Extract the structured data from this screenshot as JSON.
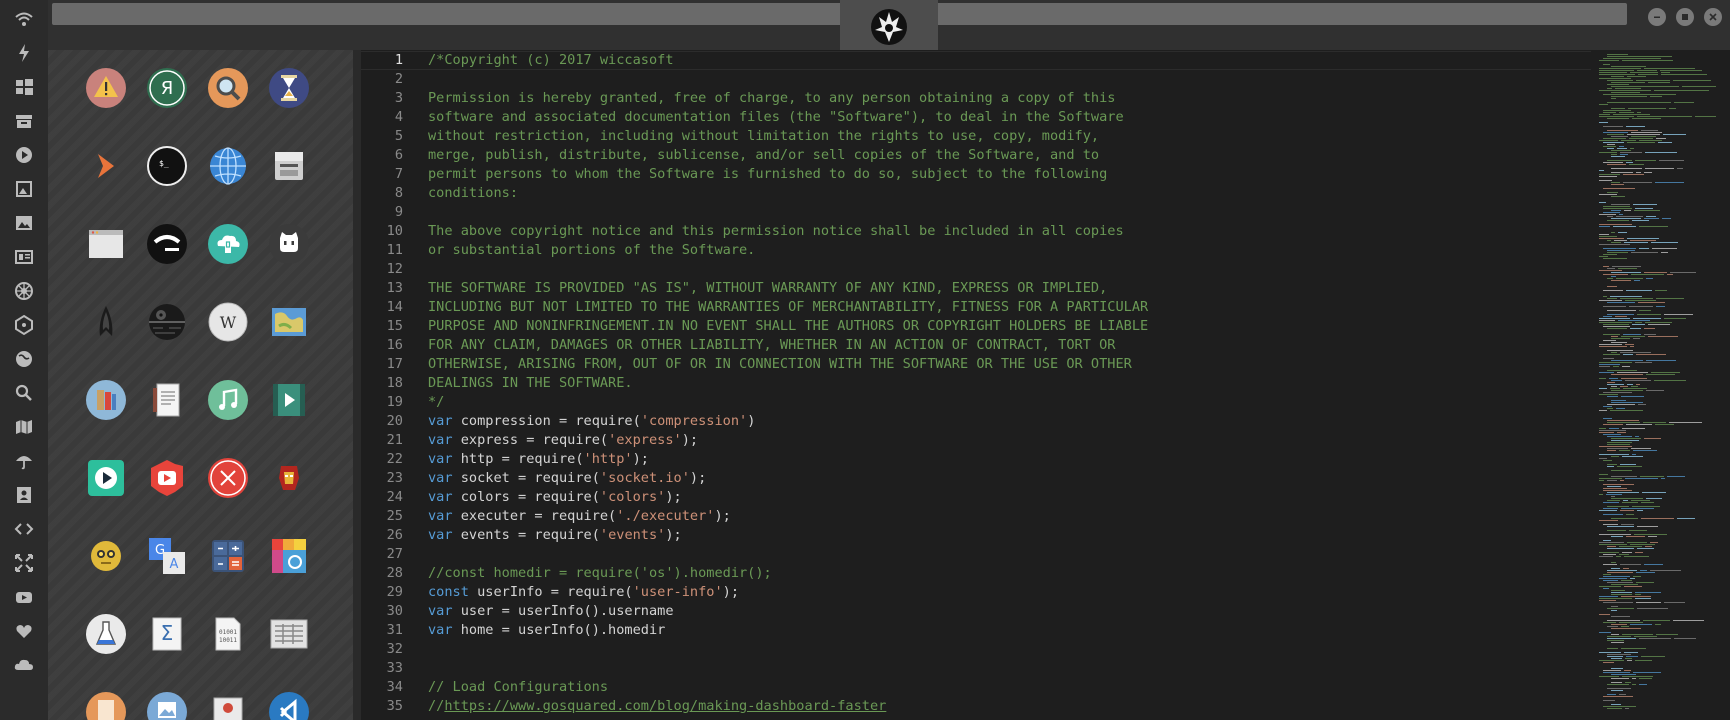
{
  "window": {
    "logo_icon": "rebel-alliance-icon",
    "controls": [
      "minimize-icon",
      "maximize-icon",
      "close-icon"
    ]
  },
  "sidebar": {
    "icons": [
      "wifi-icon",
      "bolt-icon",
      "windows-icon",
      "archive-icon",
      "play-circle-icon",
      "photo-album-icon",
      "image-icon",
      "news-icon",
      "galactic-empire-icon",
      "atom-icon",
      "globe-icon",
      "search-icon",
      "map-icon",
      "umbrella-icon",
      "contacts-icon",
      "code-icon",
      "expand-icon",
      "youtube-icon",
      "heart-icon",
      "cloud-icon"
    ]
  },
  "launcher": {
    "apps": [
      "warning-icon",
      "yandex-icon",
      "search-icon",
      "hourglass-icon",
      "terminal-prompt-icon",
      "terminal-icon",
      "globe-icon",
      "scanner-icon",
      "window-icon",
      "ubuntu-icon",
      "cloud-lock-icon",
      "github-icon",
      "star-trek-icon",
      "death-star-icon",
      "wikipedia-icon",
      "map-icon",
      "books-icon",
      "document-icon",
      "music-icon",
      "video-icon",
      "play-icon",
      "youtube-icon",
      "close-circle-icon",
      "iron-man-icon",
      "c3po-icon",
      "translate-icon",
      "calculator-icon",
      "color-picker-icon",
      "flask-icon",
      "math-icon",
      "binary-icon",
      "spreadsheet-icon",
      "text-file-icon",
      "image-viewer-icon",
      "presentation-icon",
      "vscode-icon"
    ]
  },
  "editor": {
    "active_line": 1,
    "colors": {
      "keyword": "#569cd6",
      "string": "#ce9178",
      "comment": "#6a9955",
      "text": "#d4d4d4"
    },
    "lines": [
      {
        "n": "1",
        "parts": [
          {
            "t": "/*Copyright (c) 2017 wiccasoft",
            "c": "cm"
          }
        ]
      },
      {
        "n": "2",
        "parts": []
      },
      {
        "n": "3",
        "parts": [
          {
            "t": "Permission is hereby granted, free of charge, to any person obtaining a copy of this",
            "c": "cm"
          }
        ]
      },
      {
        "n": "4",
        "parts": [
          {
            "t": "software and associated documentation files (the \"Software\"), to deal in the Software",
            "c": "cm"
          }
        ]
      },
      {
        "n": "5",
        "parts": [
          {
            "t": "without restriction, including without limitation the rights to use, copy, modify,",
            "c": "cm"
          }
        ]
      },
      {
        "n": "6",
        "parts": [
          {
            "t": "merge, publish, distribute, sublicense, and/or sell copies of the Software, and to",
            "c": "cm"
          }
        ]
      },
      {
        "n": "7",
        "parts": [
          {
            "t": "permit persons to whom the Software is furnished to do so, subject to the following",
            "c": "cm"
          }
        ]
      },
      {
        "n": "8",
        "parts": [
          {
            "t": "conditions:",
            "c": "cm"
          }
        ]
      },
      {
        "n": "9",
        "parts": []
      },
      {
        "n": "10",
        "parts": [
          {
            "t": "The above copyright notice and this permission notice shall be included in all copies",
            "c": "cm"
          }
        ]
      },
      {
        "n": "11",
        "parts": [
          {
            "t": "or substantial portions of the Software.",
            "c": "cm"
          }
        ]
      },
      {
        "n": "12",
        "parts": []
      },
      {
        "n": "13",
        "parts": [
          {
            "t": "THE SOFTWARE IS PROVIDED \"AS IS\", WITHOUT WARRANTY OF ANY KIND, EXPRESS OR IMPLIED,",
            "c": "cm"
          }
        ]
      },
      {
        "n": "14",
        "parts": [
          {
            "t": "INCLUDING BUT NOT LIMITED TO THE WARRANTIES OF MERCHANTABILITY, FITNESS FOR A PARTICULAR",
            "c": "cm"
          }
        ]
      },
      {
        "n": "15",
        "parts": [
          {
            "t": "PURPOSE AND NONINFRINGEMENT.IN NO EVENT SHALL THE AUTHORS OR COPYRIGHT HOLDERS BE LIABLE",
            "c": "cm"
          }
        ]
      },
      {
        "n": "16",
        "parts": [
          {
            "t": "FOR ANY CLAIM, DAMAGES OR OTHER LIABILITY, WHETHER IN AN ACTION OF CONTRACT, TORT OR",
            "c": "cm"
          }
        ]
      },
      {
        "n": "17",
        "parts": [
          {
            "t": "OTHERWISE, ARISING FROM, OUT OF OR IN CONNECTION WITH THE SOFTWARE OR THE USE OR OTHER",
            "c": "cm"
          }
        ]
      },
      {
        "n": "18",
        "parts": [
          {
            "t": "DEALINGS IN THE SOFTWARE.",
            "c": "cm"
          }
        ]
      },
      {
        "n": "19",
        "parts": [
          {
            "t": "*/",
            "c": "cm"
          }
        ]
      },
      {
        "n": "20",
        "parts": [
          {
            "t": "var",
            "c": "kw"
          },
          {
            "t": " compression = require(",
            "c": ""
          },
          {
            "t": "'compression'",
            "c": "str"
          },
          {
            "t": ")",
            "c": ""
          }
        ]
      },
      {
        "n": "21",
        "parts": [
          {
            "t": "var",
            "c": "kw"
          },
          {
            "t": " express = require(",
            "c": ""
          },
          {
            "t": "'express'",
            "c": "str"
          },
          {
            "t": ");",
            "c": ""
          }
        ]
      },
      {
        "n": "22",
        "parts": [
          {
            "t": "var",
            "c": "kw"
          },
          {
            "t": " http = require(",
            "c": ""
          },
          {
            "t": "'http'",
            "c": "str"
          },
          {
            "t": ");",
            "c": ""
          }
        ]
      },
      {
        "n": "23",
        "parts": [
          {
            "t": "var",
            "c": "kw"
          },
          {
            "t": " socket = require(",
            "c": ""
          },
          {
            "t": "'socket.io'",
            "c": "str"
          },
          {
            "t": ");",
            "c": ""
          }
        ]
      },
      {
        "n": "24",
        "parts": [
          {
            "t": "var",
            "c": "kw"
          },
          {
            "t": " colors = require(",
            "c": ""
          },
          {
            "t": "'colors'",
            "c": "str"
          },
          {
            "t": ");",
            "c": ""
          }
        ]
      },
      {
        "n": "25",
        "parts": [
          {
            "t": "var",
            "c": "kw"
          },
          {
            "t": " executer = require(",
            "c": ""
          },
          {
            "t": "'./executer'",
            "c": "str"
          },
          {
            "t": ");",
            "c": ""
          }
        ]
      },
      {
        "n": "26",
        "parts": [
          {
            "t": "var",
            "c": "kw"
          },
          {
            "t": " events = require(",
            "c": ""
          },
          {
            "t": "'events'",
            "c": "str"
          },
          {
            "t": ");",
            "c": ""
          }
        ]
      },
      {
        "n": "27",
        "parts": []
      },
      {
        "n": "28",
        "parts": [
          {
            "t": "//const homedir = require('os').homedir();",
            "c": "cm"
          }
        ]
      },
      {
        "n": "29",
        "parts": [
          {
            "t": "const",
            "c": "kw"
          },
          {
            "t": " userInfo = require(",
            "c": ""
          },
          {
            "t": "'user-info'",
            "c": "str"
          },
          {
            "t": ");",
            "c": ""
          }
        ]
      },
      {
        "n": "30",
        "parts": [
          {
            "t": "var",
            "c": "kw"
          },
          {
            "t": " user = userInfo().username",
            "c": ""
          }
        ]
      },
      {
        "n": "31",
        "parts": [
          {
            "t": "var",
            "c": "kw"
          },
          {
            "t": " home = userInfo().homedir",
            "c": ""
          }
        ]
      },
      {
        "n": "32",
        "parts": []
      },
      {
        "n": "33",
        "parts": []
      },
      {
        "n": "34",
        "parts": [
          {
            "t": "// Load Configurations",
            "c": "cm"
          }
        ]
      },
      {
        "n": "35",
        "parts": [
          {
            "t": "//",
            "c": "cm"
          },
          {
            "t": "https://www.gosquared.com/blog/making-dashboard-faster",
            "c": "cm link"
          }
        ]
      }
    ]
  }
}
